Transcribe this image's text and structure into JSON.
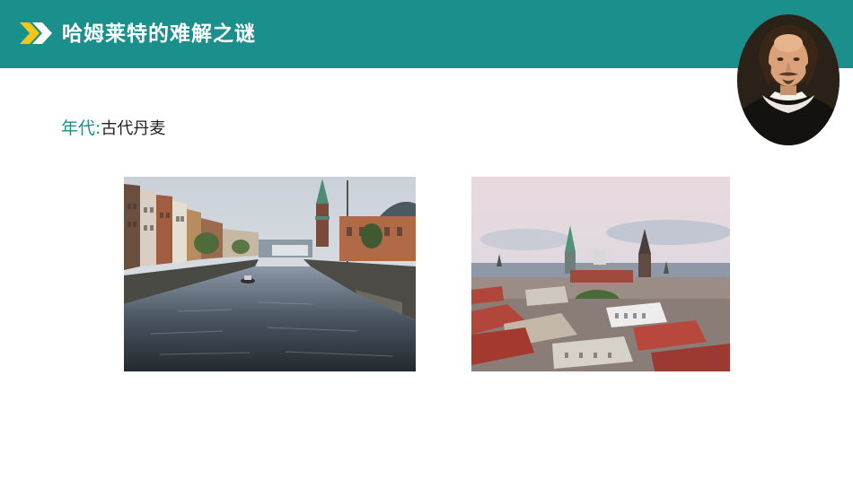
{
  "header": {
    "title": "哈姆莱特的难解之谜",
    "accent_color": "#1a8f8c",
    "chevron_color": "#f5c518",
    "icon": "double-chevron-right-icon"
  },
  "content": {
    "era_label": "年代:",
    "era_value": "古代丹麦"
  },
  "images": {
    "portrait": "shakespeare-portrait",
    "left_photo": "copenhagen-canal-photo",
    "right_photo": "copenhagen-rooftops-photo"
  }
}
